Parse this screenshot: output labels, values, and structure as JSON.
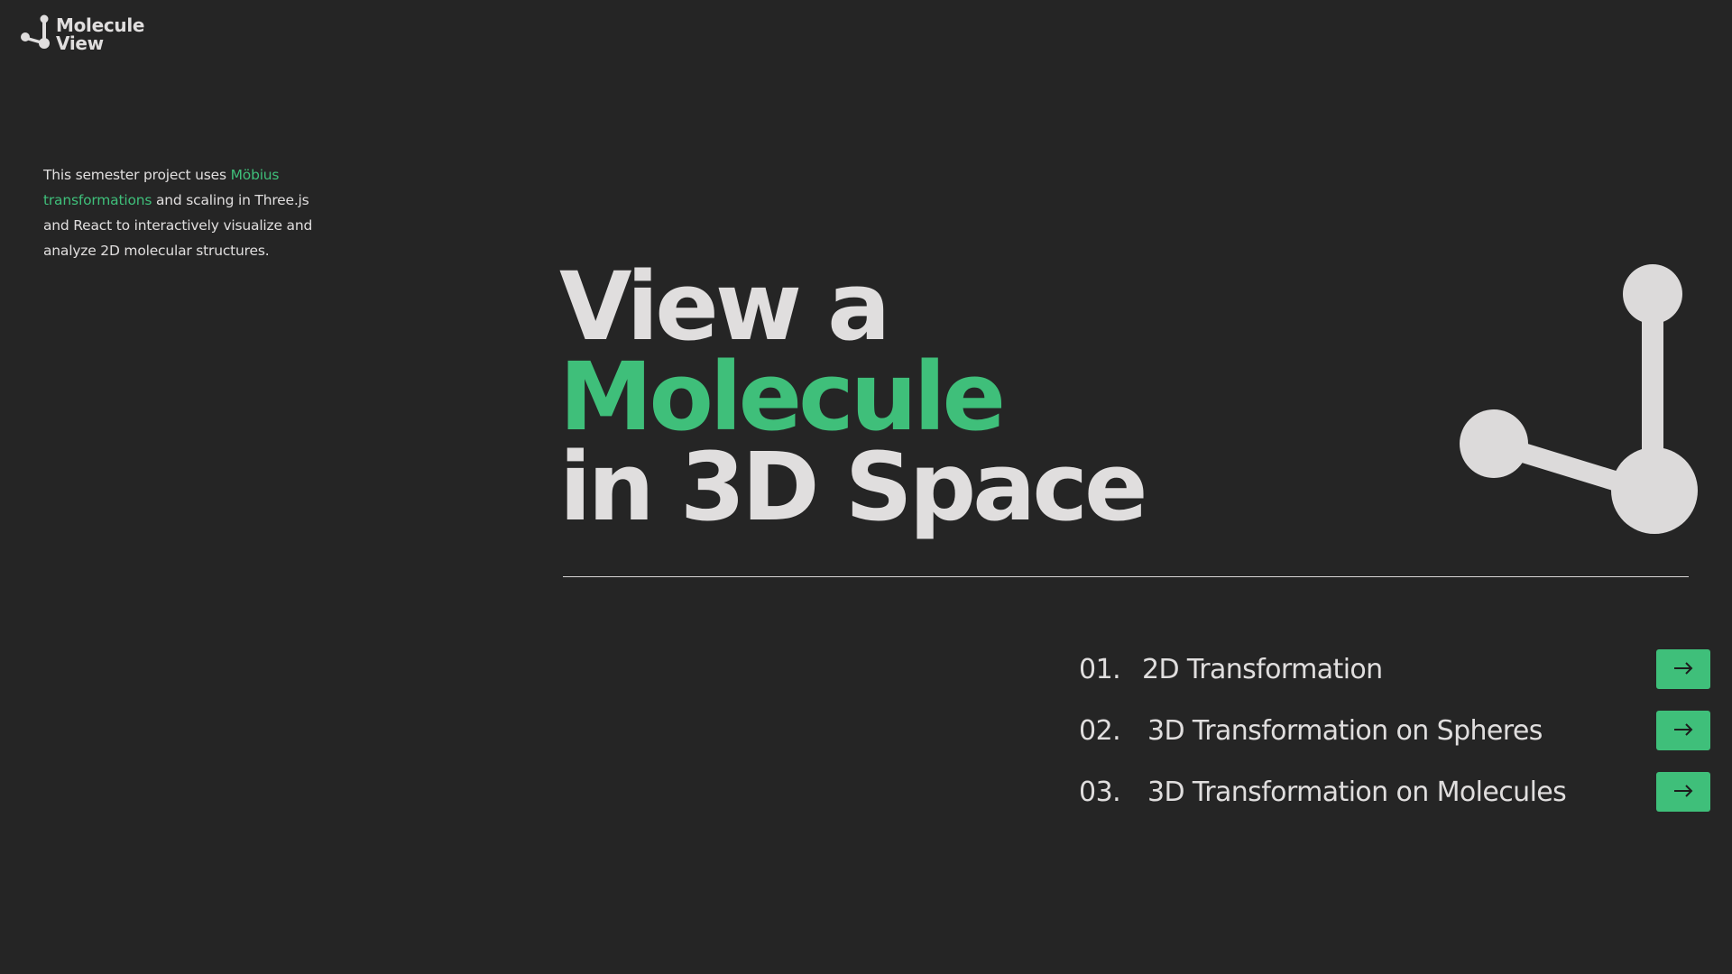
{
  "logo": {
    "line1": "Molecule",
    "line2": "View",
    "icon": "molecule-icon"
  },
  "intro": {
    "prefix": "This semester project uses ",
    "highlight": "Möbius transformations",
    "suffix": " and scaling in Three.js and React to interactively visualize and analyze 2D molecular structures."
  },
  "hero": {
    "line1": "View a",
    "line2": "Molecule",
    "line3": "in 3D Space"
  },
  "nav": {
    "items": [
      {
        "number": "01.",
        "label": "2D Transformation",
        "button_icon": "arrow-right-icon"
      },
      {
        "number": "02.",
        "label": "3D Transformation on Spheres",
        "button_icon": "arrow-right-icon"
      },
      {
        "number": "03.",
        "label": "3D Transformation on Molecules",
        "button_icon": "arrow-right-icon"
      }
    ]
  },
  "colors": {
    "background": "#252525",
    "text": "#e0dede",
    "accent": "#3fbf7a"
  }
}
